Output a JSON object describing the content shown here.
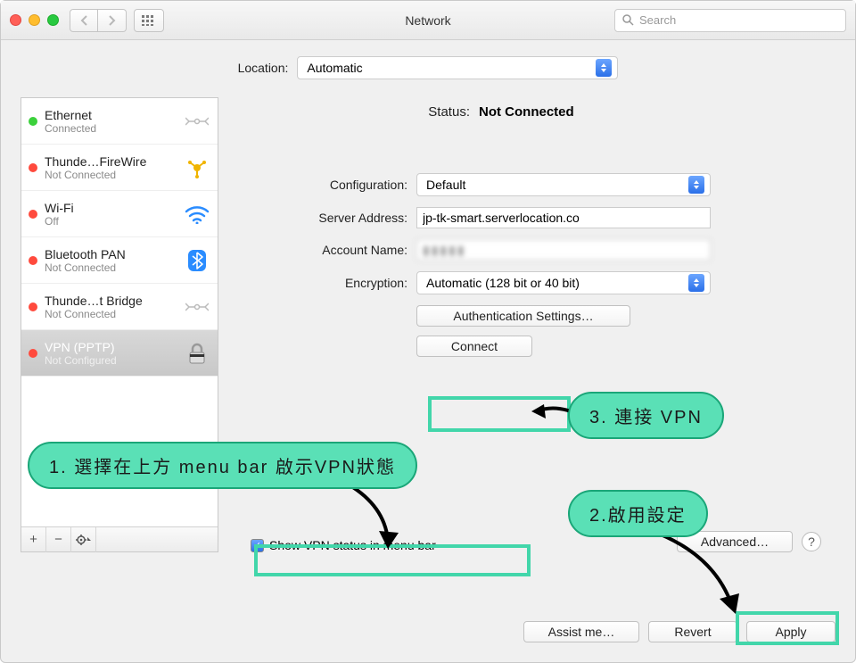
{
  "window": {
    "title": "Network"
  },
  "toolbar": {
    "search_placeholder": "Search"
  },
  "location": {
    "label": "Location:",
    "value": "Automatic"
  },
  "sidebar": {
    "items": [
      {
        "name": "Ethernet",
        "status": "Connected",
        "dot": "green",
        "icon": "ethernet"
      },
      {
        "name": "Thunde…FireWire",
        "status": "Not Connected",
        "dot": "red",
        "icon": "firewire"
      },
      {
        "name": "Wi-Fi",
        "status": "Off",
        "dot": "red",
        "icon": "wifi"
      },
      {
        "name": "Bluetooth PAN",
        "status": "Not Connected",
        "dot": "red",
        "icon": "bluetooth"
      },
      {
        "name": "Thunde…t Bridge",
        "status": "Not Connected",
        "dot": "red",
        "icon": "ethernet"
      },
      {
        "name": "VPN (PPTP)",
        "status": "Not Configured",
        "dot": "red",
        "icon": "lock"
      }
    ],
    "add": "+",
    "remove": "−",
    "gear": "✻"
  },
  "detail": {
    "status_label": "Status:",
    "status_value": "Not Connected",
    "configuration_label": "Configuration:",
    "configuration_value": "Default",
    "server_label": "Server Address:",
    "server_value": "jp-tk-smart.serverlocation.co",
    "account_label": "Account Name:",
    "account_value": "▮▮▮▮▮",
    "encryption_label": "Encryption:",
    "encryption_value": "Automatic (128 bit or 40 bit)",
    "auth_button": "Authentication Settings…",
    "connect_button": "Connect",
    "show_menubar_label": "Show VPN status in menu bar",
    "advanced_button": "Advanced…",
    "help": "?"
  },
  "bottom": {
    "assist": "Assist me…",
    "revert": "Revert",
    "apply": "Apply"
  },
  "annotations": {
    "step1": "1. 選擇在上方 menu bar 啟示VPN狀態",
    "step2": "2.啟用設定",
    "step3": "3. 連接 VPN"
  }
}
